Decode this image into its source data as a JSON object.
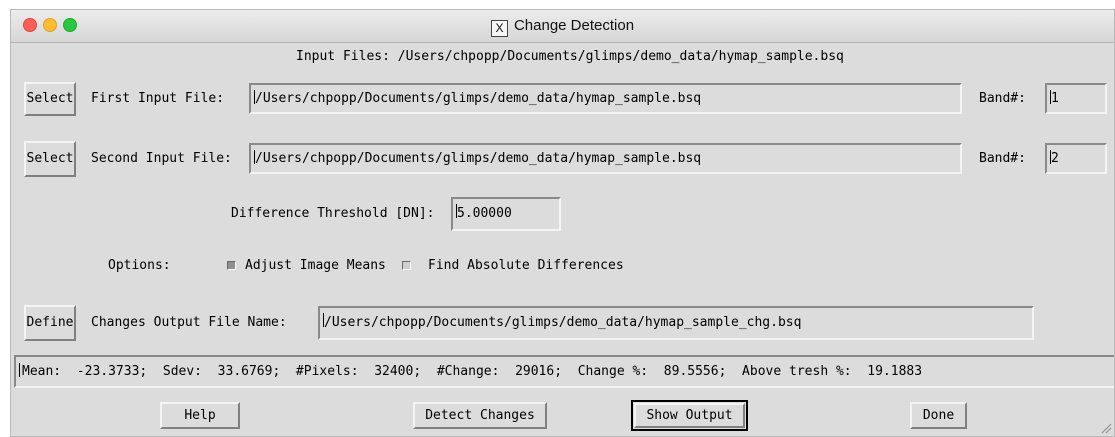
{
  "window": {
    "title": "Change Detection",
    "title_icon": "X"
  },
  "header": {
    "input_files": "Input Files: /Users/chpopp/Documents/glimps/demo_data/hymap_sample.bsq"
  },
  "first_input": {
    "button_label": "Select",
    "label": "First Input File:",
    "path": "/Users/chpopp/Documents/glimps/demo_data/hymap_sample.bsq",
    "band_label": "Band#:",
    "band_value": "1"
  },
  "second_input": {
    "button_label": "Select",
    "label": "Second Input File:",
    "path": "/Users/chpopp/Documents/glimps/demo_data/hymap_sample.bsq",
    "band_label": "Band#:",
    "band_value": "2"
  },
  "threshold": {
    "label": "Difference Threshold [DN]:",
    "value": "5.00000"
  },
  "options": {
    "label": "Options:",
    "items": [
      {
        "label": "Adjust Image Means",
        "checked": true
      },
      {
        "label": "Find Absolute Differences",
        "checked": false
      }
    ]
  },
  "output": {
    "button_label": "Define",
    "label": "Changes Output File Name:",
    "path": "/Users/chpopp/Documents/glimps/demo_data/hymap_sample_chg.bsq"
  },
  "status": {
    "text": "Mean:  -23.3733;  Sdev:  33.6769;  #Pixels:  32400;  #Change:  29016;  Change %:  89.5556;  Above tresh %:  19.1883"
  },
  "buttons": {
    "help": "Help",
    "detect": "Detect Changes",
    "show_output": "Show Output",
    "done": "Done"
  }
}
